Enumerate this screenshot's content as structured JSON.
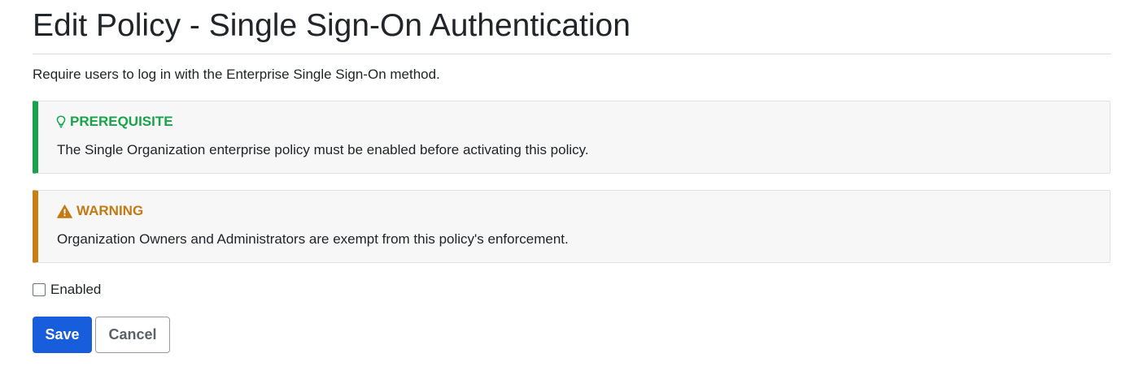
{
  "header": {
    "title": "Edit Policy - Single Sign-On Authentication"
  },
  "description": "Require users to log in with the Enterprise Single Sign-On method.",
  "callouts": {
    "prerequisite": {
      "icon": "lightbulb-icon",
      "title": "PREREQUISITE",
      "text": "The Single Organization enterprise policy must be enabled before activating this policy.",
      "color": "#18a44b"
    },
    "warning": {
      "icon": "warning-icon",
      "title": "WARNING",
      "text": "Organization Owners and Administrators are exempt from this policy's enforcement.",
      "color": "#c37a12"
    }
  },
  "form": {
    "enabled_label": "Enabled",
    "enabled_checked": false
  },
  "actions": {
    "save_label": "Save",
    "cancel_label": "Cancel",
    "primary_color": "#175ddc"
  }
}
